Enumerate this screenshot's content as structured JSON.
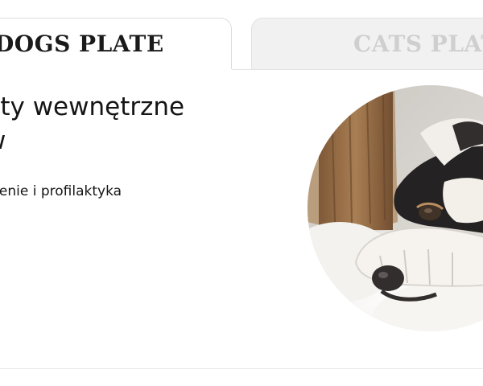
{
  "tabs": [
    {
      "label": "DOGS PLATE",
      "active": true
    },
    {
      "label": "CATS PLATE",
      "active": false
    }
  ],
  "content": {
    "title": "yty wewnętrzne\nw",
    "title_line1": "yty wewnętrzne",
    "title_line2": "w",
    "subtitle": "zenie i profilaktyka"
  },
  "image": {
    "subject": "dog-lying-with-paw-over-face-icon"
  },
  "colors": {
    "active_tab_text": "#1a1a1a",
    "inactive_tab_text": "#cfcfcf",
    "inactive_tab_bg": "#f1f1f1",
    "border": "#dcdcdc"
  }
}
